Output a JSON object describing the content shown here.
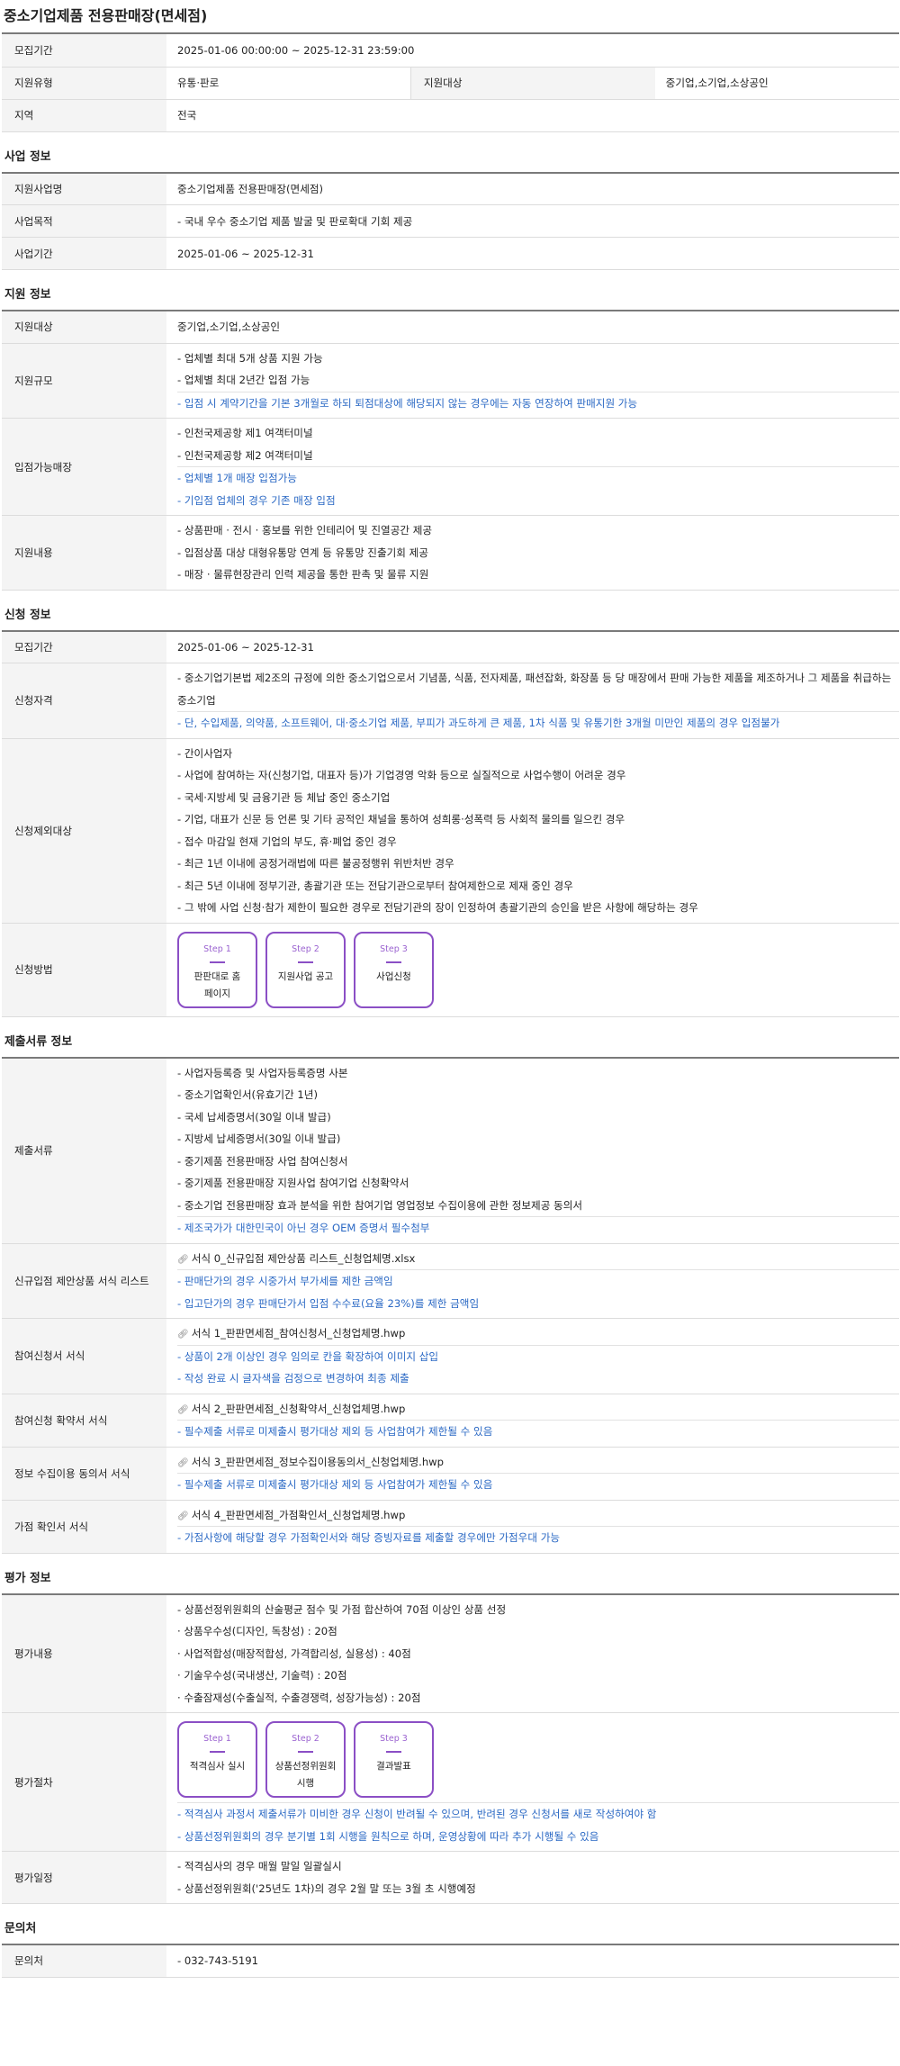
{
  "title": "중소기업제품 전용판매장(면세점)",
  "overview": {
    "period_label": "모집기간",
    "period_value": "2025-01-06 00:00:00 ~ 2025-12-31 23:59:00",
    "type_label": "지원유형",
    "type_value": "유통·판로",
    "target_label": "지원대상",
    "target_value": "중기업,소기업,소상공인",
    "region_label": "지역",
    "region_value": "전국"
  },
  "business": {
    "heading": "사업 정보",
    "name_label": "지원사업명",
    "name_value": "중소기업제품 전용판매장(면세점)",
    "purpose_label": "사업목적",
    "purpose_value": "- 국내 우수 중소기업 제품 발굴 및 판로확대 기회 제공",
    "period_label": "사업기간",
    "period_value": "2025-01-06 ~ 2025-12-31"
  },
  "support": {
    "heading": "지원 정보",
    "target_label": "지원대상",
    "target_value": "중기업,소기업,소상공인",
    "scale_label": "지원규모",
    "scale_lines": [
      "- 업체별 최대 5개 상품 지원 가능",
      "- 업체별 최대 2년간 입점 가능"
    ],
    "scale_note": "- 입점 시 계약기간을 기본 3개월로 하되 퇴점대상에 해당되지 않는 경우에는 자동 연장하여 판매지원 가능",
    "stores_label": "입점가능매장",
    "stores_lines": [
      "- 인천국제공항 제1 여객터미널",
      "- 인천국제공항 제2 여객터미널"
    ],
    "stores_notes": [
      "- 업체별 1개 매장 입점가능",
      "- 기입점 업체의 경우 기존 매장 입점"
    ],
    "content_label": "지원내용",
    "content_lines": [
      "- 상품판매 · 전시 · 홍보를 위한 인테리어 및 진열공간 제공",
      "- 입점상품 대상 대형유통망 연계 등 유통망 진출기회 제공",
      "- 매장 · 물류현장관리 인력 제공을 통한 판촉 및 물류 지원"
    ]
  },
  "apply": {
    "heading": "신청 정보",
    "period_label": "모집기간",
    "period_value": "2025-01-06 ~ 2025-12-31",
    "qual_label": "신청자격",
    "qual_text": "- 중소기업기본법 제2조의 규정에 의한 중소기업으로서 기념품, 식품, 전자제품, 패션잡화, 화장품 등 당 매장에서 판매 가능한 제품을 제조하거나 그 제품을 취급하는 중소기업",
    "qual_note": "- 단, 수입제품, 의약품, 소프트웨어, 대·중소기업 제품, 부피가 과도하게 큰 제품, 1차 식품 및 유통기한 3개월 미만인 제품의 경우 입점불가",
    "excl_label": "신청제외대상",
    "excl_lines": [
      "- 간이사업자",
      "- 사업에 참여하는 자(신청기업, 대표자 등)가 기업경영 악화 등으로 실질적으로 사업수행이 어려운 경우",
      "- 국세·지방세 및 금융기관 등 체납 중인 중소기업",
      "- 기업, 대표가 신문 등 언론 및 기타 공적인 채널을 통하여 성희롱·성폭력 등 사회적 물의를 일으킨 경우",
      "- 접수 마감일 현재 기업의 부도, 휴·폐업 중인 경우",
      "- 최근 1년 이내에 공정거래법에 따른 불공정행위 위반처반 경우",
      "- 최근 5년 이내에 정부기관, 총괄기관 또는 전담기관으로부터 참여제한으로 제재 중인 경우",
      "- 그 밖에 사업 신청·참가 제한이 필요한 경우로 전담기관의 장이 인정하여 총괄기관의 승인을 받은 사항에 해당하는 경우"
    ],
    "method_label": "신청방법",
    "steps": [
      {
        "no": "Step 1",
        "label": "판판대로 홈페이지"
      },
      {
        "no": "Step 2",
        "label": "지원사업 공고"
      },
      {
        "no": "Step 3",
        "label": "사업신청"
      }
    ]
  },
  "docs": {
    "heading": "제출서류 정보",
    "docs_label": "제출서류",
    "docs_lines": [
      "- 사업자등록증 및 사업자등록증명 사본",
      "- 중소기업확인서(유효기간 1년)",
      "- 국세 납세증명서(30일 이내 발급)",
      "- 지방세 납세증명서(30일 이내 발급)",
      "- 중기제품 전용판매장 사업 참여신청서",
      "- 중기제품 전용판매장 지원사업 참여기업 신청확약서",
      "- 중소기업 전용판매장 효과 분석을 위한 참여기업 영업정보 수집이용에 관한 정보제공 동의서"
    ],
    "docs_note": "- 제조국가가 대한민국이 아닌 경우 OEM 증명서 필수첨부",
    "list_label": "신규입점 제안상품 서식 리스트",
    "list_file": "서식 0_신규입점 제안상품 리스트_신청업체명.xlsx",
    "list_notes": [
      "- 판매단가의 경우 시중가서 부가세를 제한 금액임",
      "- 입고단가의 경우 판매단가서 입점 수수료(요율 23%)를 제한 금액임"
    ],
    "form1_label": "참여신청서 서식",
    "form1_file": "서식 1_판판면세점_참여신청서_신청업체명.hwp",
    "form1_notes": [
      "- 상품이 2개 이상인 경우 임의로 칸을 확장하여 이미지 삽입",
      "- 작성 완료 시 글자색을 검정으로 변경하여 최종 제출"
    ],
    "form2_label": "참여신청 확약서 서식",
    "form2_file": "서식 2_판판면세점_신청확약서_신청업체명.hwp",
    "form2_note": "- 필수제출 서류로 미제출시 평가대상 제외 등 사업참여가 제한될 수 있음",
    "form3_label": "정보 수집이용 동의서 서식",
    "form3_file": "서식 3_판판면세점_정보수집이용동의서_신청업체명.hwp",
    "form3_note": "- 필수제출 서류로 미제출시 평가대상 제외 등 사업참여가 제한될 수 있음",
    "form4_label": "가점 확인서 서식",
    "form4_file": "서식 4_판판면세점_가점확인서_신청업체명.hwp",
    "form4_note": "- 가점사항에 해당할 경우 가점확인서와 해당 증빙자료를 제출할 경우에만 가점우대 가능"
  },
  "evaluation": {
    "heading": "평가 정보",
    "content_label": "평가내용",
    "content_lines": [
      "- 상품선정위원회의 산술평균 점수 및 가점 합산하여 70점 이상인 상품 선정",
      "· 상품우수성(디자인, 독창성) : 20점",
      "· 사업적합성(매장적합성, 가격합리성, 실용성) : 40점",
      "· 기술우수성(국내생산, 기술력) : 20점",
      "· 수출잠재성(수출실적, 수출경쟁력, 성장가능성) : 20점"
    ],
    "process_label": "평가절차",
    "steps": [
      {
        "no": "Step 1",
        "label": "적격심사 실시"
      },
      {
        "no": "Step 2",
        "label": "상품선정위원회 시행"
      },
      {
        "no": "Step 3",
        "label": "결과발표"
      }
    ],
    "process_notes": [
      "- 적격심사 과정서 제출서류가 미비한 경우 신청이 반려될 수 있으며, 반려된 경우 신청서를 새로 작성하여야 함",
      "- 상품선정위원회의 경우 분기별 1회 시행을 원칙으로 하며, 운영상황에 따라 추가 시행될 수 있음"
    ],
    "schedule_label": "평가일정",
    "schedule_lines": [
      "- 적격심사의 경우 매월 말일 일괄실시",
      "- 상품선정위원회('25년도 1차)의 경우 2월 말 또는 3월 초 시행예정"
    ]
  },
  "contact": {
    "heading": "문의처",
    "label": "문의처",
    "value": "- 032-743-5191"
  }
}
